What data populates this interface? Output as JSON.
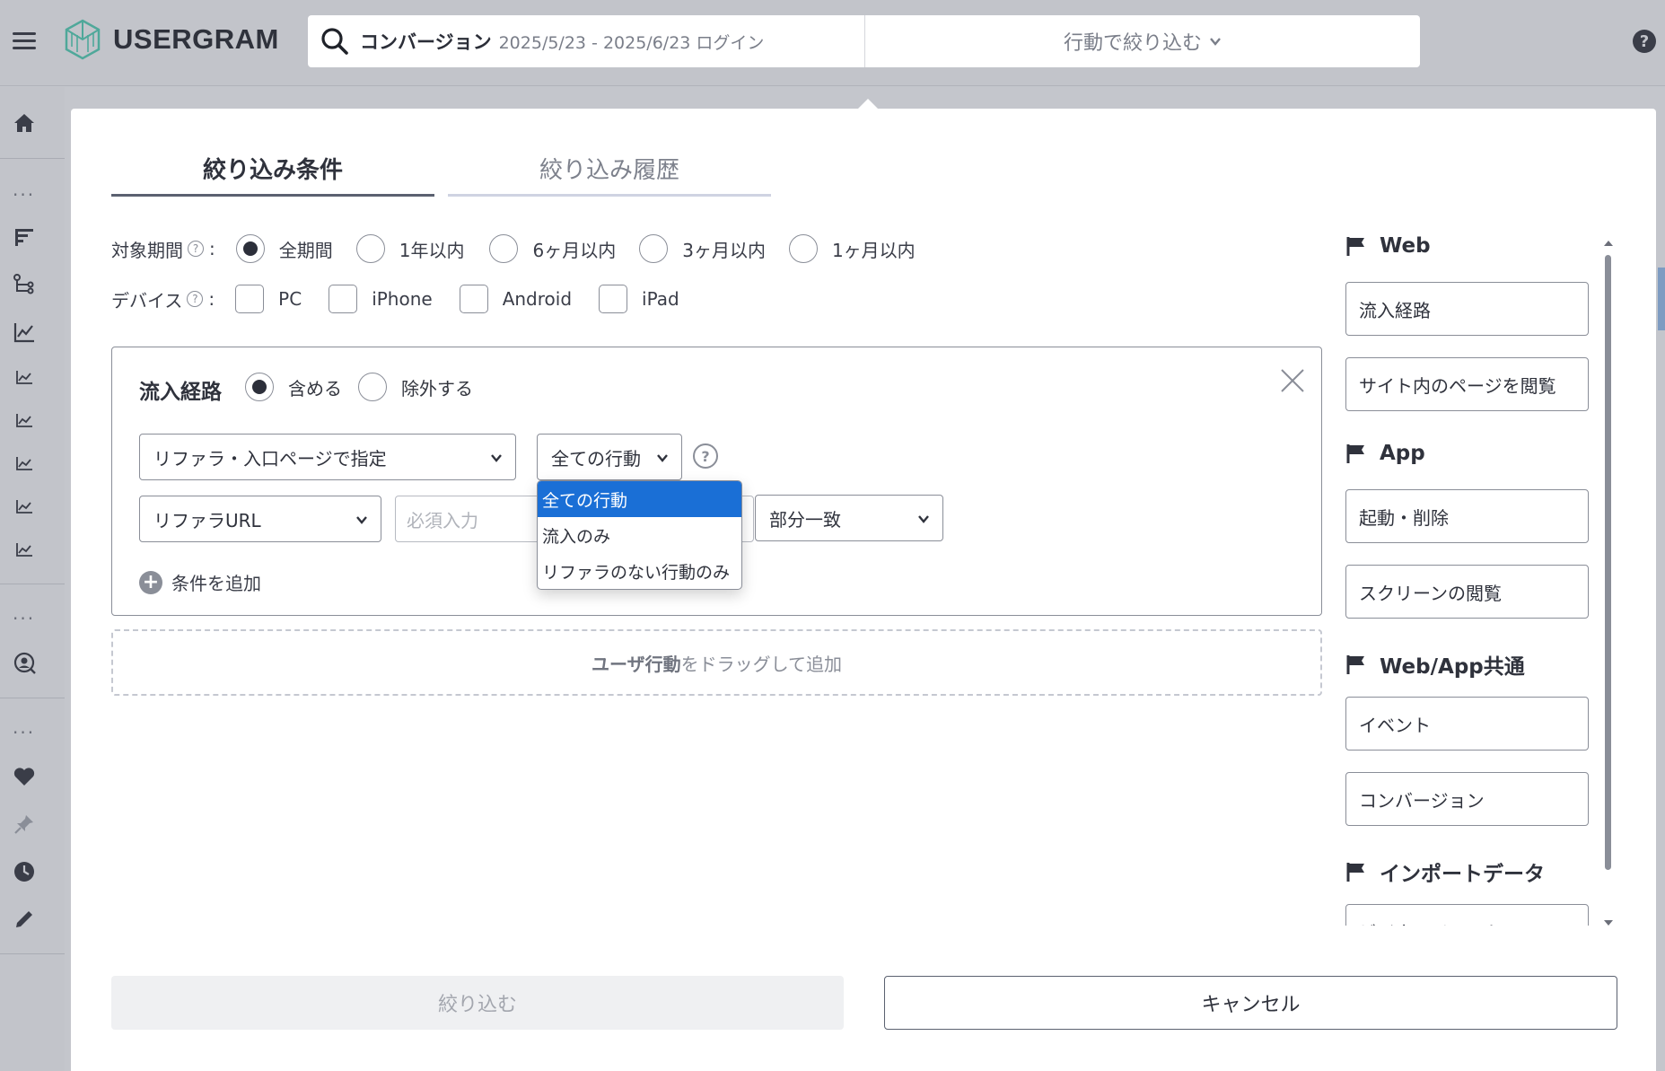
{
  "header": {
    "logo_text": "USERGRAM",
    "search_title": "コンバージョン",
    "search_sub": "2025/5/23 - 2025/6/23 ログイン",
    "filter_by_action": "行動で絞り込む",
    "help": "?"
  },
  "sidebar": {
    "dots": "···"
  },
  "tabs": {
    "conditions": "絞り込み条件",
    "history": "絞り込み履歴"
  },
  "period": {
    "label": "対象期間",
    "colon": ":",
    "options": [
      "全期間",
      "1年以内",
      "6ヶ月以内",
      "3ヶ月以内",
      "1ヶ月以内"
    ],
    "selected": "全期間"
  },
  "device": {
    "label": "デバイス",
    "colon": ":",
    "options": [
      "PC",
      "iPhone",
      "Android",
      "iPad"
    ]
  },
  "condition": {
    "title": "流入経路",
    "include": "含める",
    "exclude": "除外する",
    "mode_select": "リファラ・入口ページで指定",
    "action_select": "全ての行動",
    "field_select": "リファラURL",
    "value_placeholder": "必須入力",
    "match_select": "部分一致",
    "add_condition": "条件を追加"
  },
  "dropdown": {
    "options": [
      "全ての行動",
      "流入のみ",
      "リファラのない行動のみ"
    ],
    "selected_index": 0
  },
  "dropzone": {
    "bold": "ユーザ行動",
    "rest": "をドラッグして追加"
  },
  "palette": {
    "groups": [
      {
        "title": "Web",
        "items": [
          "流入経路",
          "サイト内のページを閲覧"
        ]
      },
      {
        "title": "App",
        "items": [
          "起動・削除",
          "スクリーンの閲覧"
        ]
      },
      {
        "title": "Web/App共通",
        "items": [
          "イベント",
          "コンバージョン"
        ]
      },
      {
        "title": "インポートデータ",
        "items": [
          "ビジネスイベント"
        ]
      }
    ]
  },
  "footer": {
    "submit": "絞り込む",
    "cancel": "キャンセル"
  }
}
